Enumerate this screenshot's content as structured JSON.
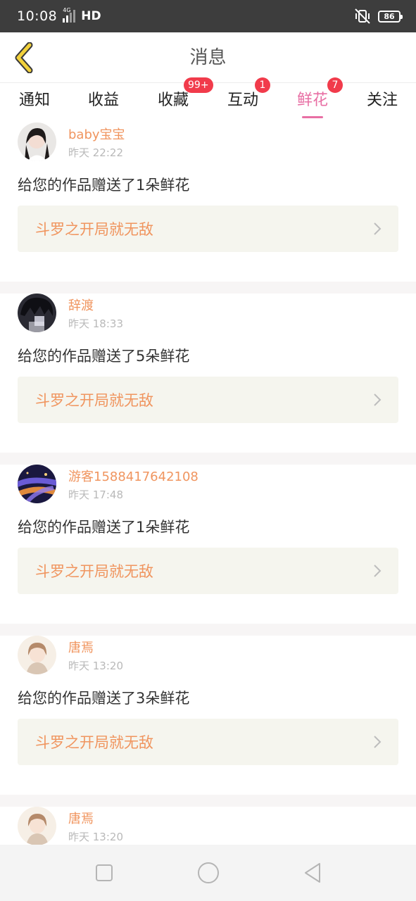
{
  "status_bar": {
    "time": "10:08",
    "network": "4G",
    "hd": "HD",
    "battery": "86"
  },
  "header": {
    "title": "消息"
  },
  "tabs": [
    {
      "label": "通知",
      "badge": null
    },
    {
      "label": "收益",
      "badge": null
    },
    {
      "label": "收藏",
      "badge": "99+"
    },
    {
      "label": "互动",
      "badge": "1"
    },
    {
      "label": "鲜花",
      "badge": "7",
      "active": true
    },
    {
      "label": "关注",
      "badge": null
    }
  ],
  "messages": [
    {
      "username": "baby宝宝",
      "time": "昨天 22:22",
      "text": "给您的作品赠送了1朵鲜花",
      "book": "斗罗之开局就无敌",
      "avatar": "avatar-girl"
    },
    {
      "username": "辞渡",
      "time": "昨天 18:33",
      "text": "给您的作品赠送了5朵鲜花",
      "book": "斗罗之开局就无敌",
      "avatar": "avatar-dark-boy"
    },
    {
      "username": "游客1588417642108",
      "time": "昨天 17:48",
      "text": "给您的作品赠送了1朵鲜花",
      "book": "斗罗之开局就无敌",
      "avatar": "avatar-night-road"
    },
    {
      "username": "唐焉",
      "time": "昨天 13:20",
      "text": "给您的作品赠送了3朵鲜花",
      "book": "斗罗之开局就无敌",
      "avatar": "avatar-anime-boy"
    },
    {
      "username": "唐焉",
      "time": "昨天 13:20",
      "text": "",
      "book": "",
      "avatar": "avatar-anime-boy"
    }
  ],
  "colors": {
    "accent_pink": "#e86fa4",
    "accent_orange": "#f0955f",
    "badge_red": "#f13b4b",
    "back_yellow": "#f2d13b"
  }
}
